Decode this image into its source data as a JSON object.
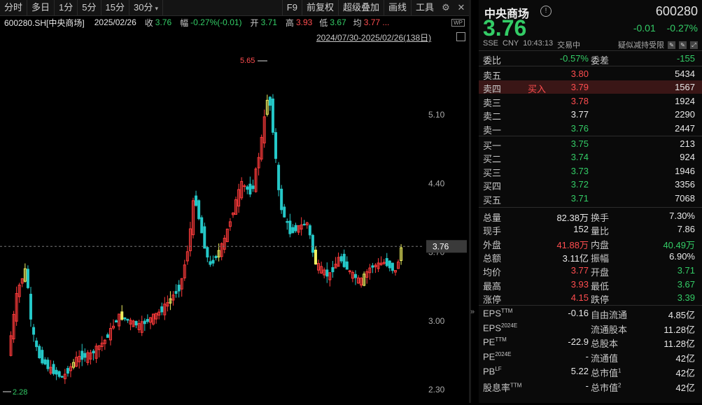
{
  "toolbar": {
    "left": [
      "分时",
      "多日",
      "1分",
      "5分",
      "15分",
      "30分"
    ],
    "right": [
      "F9",
      "前复权",
      "超级叠加",
      "画线",
      "工具"
    ]
  },
  "info": {
    "code": "600280.SH[中央商场]",
    "date": "2025/02/26",
    "close_label": "收",
    "close": "3.76",
    "chg_label": "幅",
    "chg": "-0.27%(-0.01)",
    "open_label": "开",
    "open": "3.71",
    "high_label": "高",
    "high": "3.93",
    "low_label": "低",
    "low": "3.67",
    "avg_label": "均",
    "avg": "3.77 ..."
  },
  "range": "2024/07/30-2025/02/26(138日)",
  "chart_data": {
    "type": "candlestick",
    "yticks": [
      "5.10",
      "4.40",
      "3.70",
      "3.00",
      "2.30"
    ],
    "ylim": [
      2.28,
      5.65
    ],
    "max_label": "5.65",
    "min_label": "2.28",
    "last_price": "3.76",
    "up_color": "#ff3b3b",
    "down_color": "#25c8c8",
    "limit_color": "#f0f060"
  },
  "quote": {
    "name": "中央商场",
    "code": "600280",
    "price": "3.76",
    "change": "-0.01",
    "change_pct": "-0.27%",
    "exchange": "SSE",
    "currency": "CNY",
    "time": "10:43:13",
    "status": "交易中",
    "tag": "疑似减持受限",
    "weibi_label": "委比",
    "weibi": "-0.57%",
    "weicha_label": "委差",
    "weicha": "-155",
    "asks": [
      {
        "label": "卖五",
        "price": "3.80",
        "vol": "5434",
        "note": ""
      },
      {
        "label": "卖四",
        "price": "3.79",
        "vol": "1567",
        "note": "买入"
      },
      {
        "label": "卖三",
        "price": "3.78",
        "vol": "1924",
        "note": ""
      },
      {
        "label": "卖二",
        "price": "3.77",
        "vol": "2290",
        "note": ""
      },
      {
        "label": "卖一",
        "price": "3.76",
        "vol": "2447",
        "note": ""
      }
    ],
    "bids": [
      {
        "label": "买一",
        "price": "3.75",
        "vol": "213"
      },
      {
        "label": "买二",
        "price": "3.74",
        "vol": "924"
      },
      {
        "label": "买三",
        "price": "3.73",
        "vol": "1946"
      },
      {
        "label": "买四",
        "price": "3.72",
        "vol": "3356"
      },
      {
        "label": "买五",
        "price": "3.71",
        "vol": "7068"
      }
    ],
    "stats": [
      {
        "l1": "总量",
        "v1": "82.38万",
        "c1": "w",
        "l2": "换手",
        "v2": "7.30%",
        "c2": "w"
      },
      {
        "l1": "现手",
        "v1": "152",
        "c1": "w",
        "l2": "量比",
        "v2": "7.86",
        "c2": "w"
      },
      {
        "l1": "外盘",
        "v1": "41.88万",
        "c1": "r",
        "l2": "内盘",
        "v2": "40.49万",
        "c2": "g"
      },
      {
        "l1": "总额",
        "v1": "3.11亿",
        "c1": "w",
        "l2": "振幅",
        "v2": "6.90%",
        "c2": "w"
      },
      {
        "l1": "均价",
        "v1": "3.77",
        "c1": "r",
        "l2": "开盘",
        "v2": "3.71",
        "c2": "g"
      },
      {
        "l1": "最高",
        "v1": "3.93",
        "c1": "r",
        "l2": "最低",
        "v2": "3.67",
        "c2": "g"
      },
      {
        "l1": "涨停",
        "v1": "4.15",
        "c1": "r",
        "l2": "跌停",
        "v2": "3.39",
        "c2": "g"
      }
    ],
    "fund": [
      {
        "l1": "EPS",
        "s1": "TTM",
        "v1": "-0.16",
        "l2": "自由流通",
        "s2": "",
        "v2": "4.85亿"
      },
      {
        "l1": "EPS",
        "s1": "2024E",
        "v1": "",
        "l2": "流通股本",
        "s2": "",
        "v2": "11.28亿"
      },
      {
        "l1": "PE",
        "s1": "TTM",
        "v1": "-22.9",
        "l2": "总股本",
        "s2": "",
        "v2": "11.28亿"
      },
      {
        "l1": "PE",
        "s1": "2024E",
        "v1": "-",
        "l2": "流通值",
        "s2": "",
        "v2": "42亿"
      },
      {
        "l1": "PB",
        "s1": "LF",
        "v1": "5.22",
        "l2": "总市值",
        "s2": "1",
        "v2": "42亿"
      },
      {
        "l1": "股息率",
        "s1": "TTM",
        "v1": "-",
        "l2": "总市值",
        "s2": "2",
        "v2": "42亿"
      }
    ]
  }
}
